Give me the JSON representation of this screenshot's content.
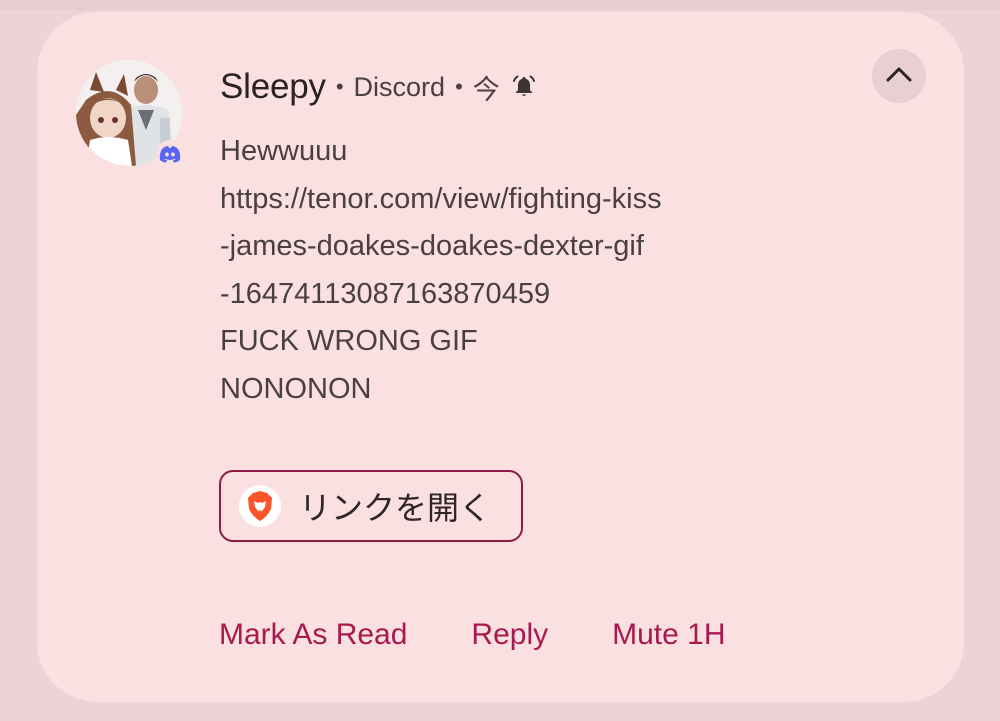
{
  "notification": {
    "sender": "Sleepy",
    "separator": "•",
    "app_name": "Discord",
    "time": "今",
    "avatar_icon": "avatar-image",
    "app_badge_icon": "discord-icon",
    "bell_icon": "bell-icon",
    "collapse_icon": "chevron-up-icon",
    "message_lines": [
      "Hewwuuu",
      "https://tenor.com/view/fighting-kiss",
      "-james-doakes-doakes-dexter-gif",
      "-16474113087163870459",
      "FUCK WRONG GIF",
      "NONONON"
    ],
    "open_link": {
      "label": "リンクを開く",
      "icon": "brave-browser-icon"
    },
    "actions": {
      "mark_read": "Mark As Read",
      "reply": "Reply",
      "mute": "Mute 1H"
    }
  },
  "colors": {
    "background": "#ecd4d6",
    "card": "#fbe0e1",
    "accent": "#a8194f",
    "button_border": "#8b1d44",
    "text": "#4a4041",
    "discord_blue": "#5865f2",
    "brave_orange": "#fb542b"
  }
}
